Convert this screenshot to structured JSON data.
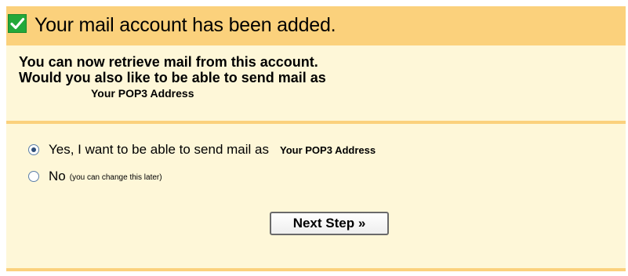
{
  "header": {
    "title": "Your mail account has been added.",
    "icon": "checkmark-icon",
    "accent_color": "#fbd17c",
    "check_color": "#22a83a"
  },
  "intro": {
    "line1": "You can now retrieve mail from this account.",
    "line2": "Would you also like to be able to send mail as",
    "address": "Your POP3 Address"
  },
  "options": [
    {
      "label": "Yes, I want to be able to send mail as",
      "address": "Your POP3 Address",
      "selected": true
    },
    {
      "label": "No",
      "note": "(you can change this later)",
      "selected": false
    }
  ],
  "buttons": {
    "next_label": "Next Step »"
  },
  "colors": {
    "panel_background": "#fef7d8",
    "header_background": "#fbd17c"
  }
}
